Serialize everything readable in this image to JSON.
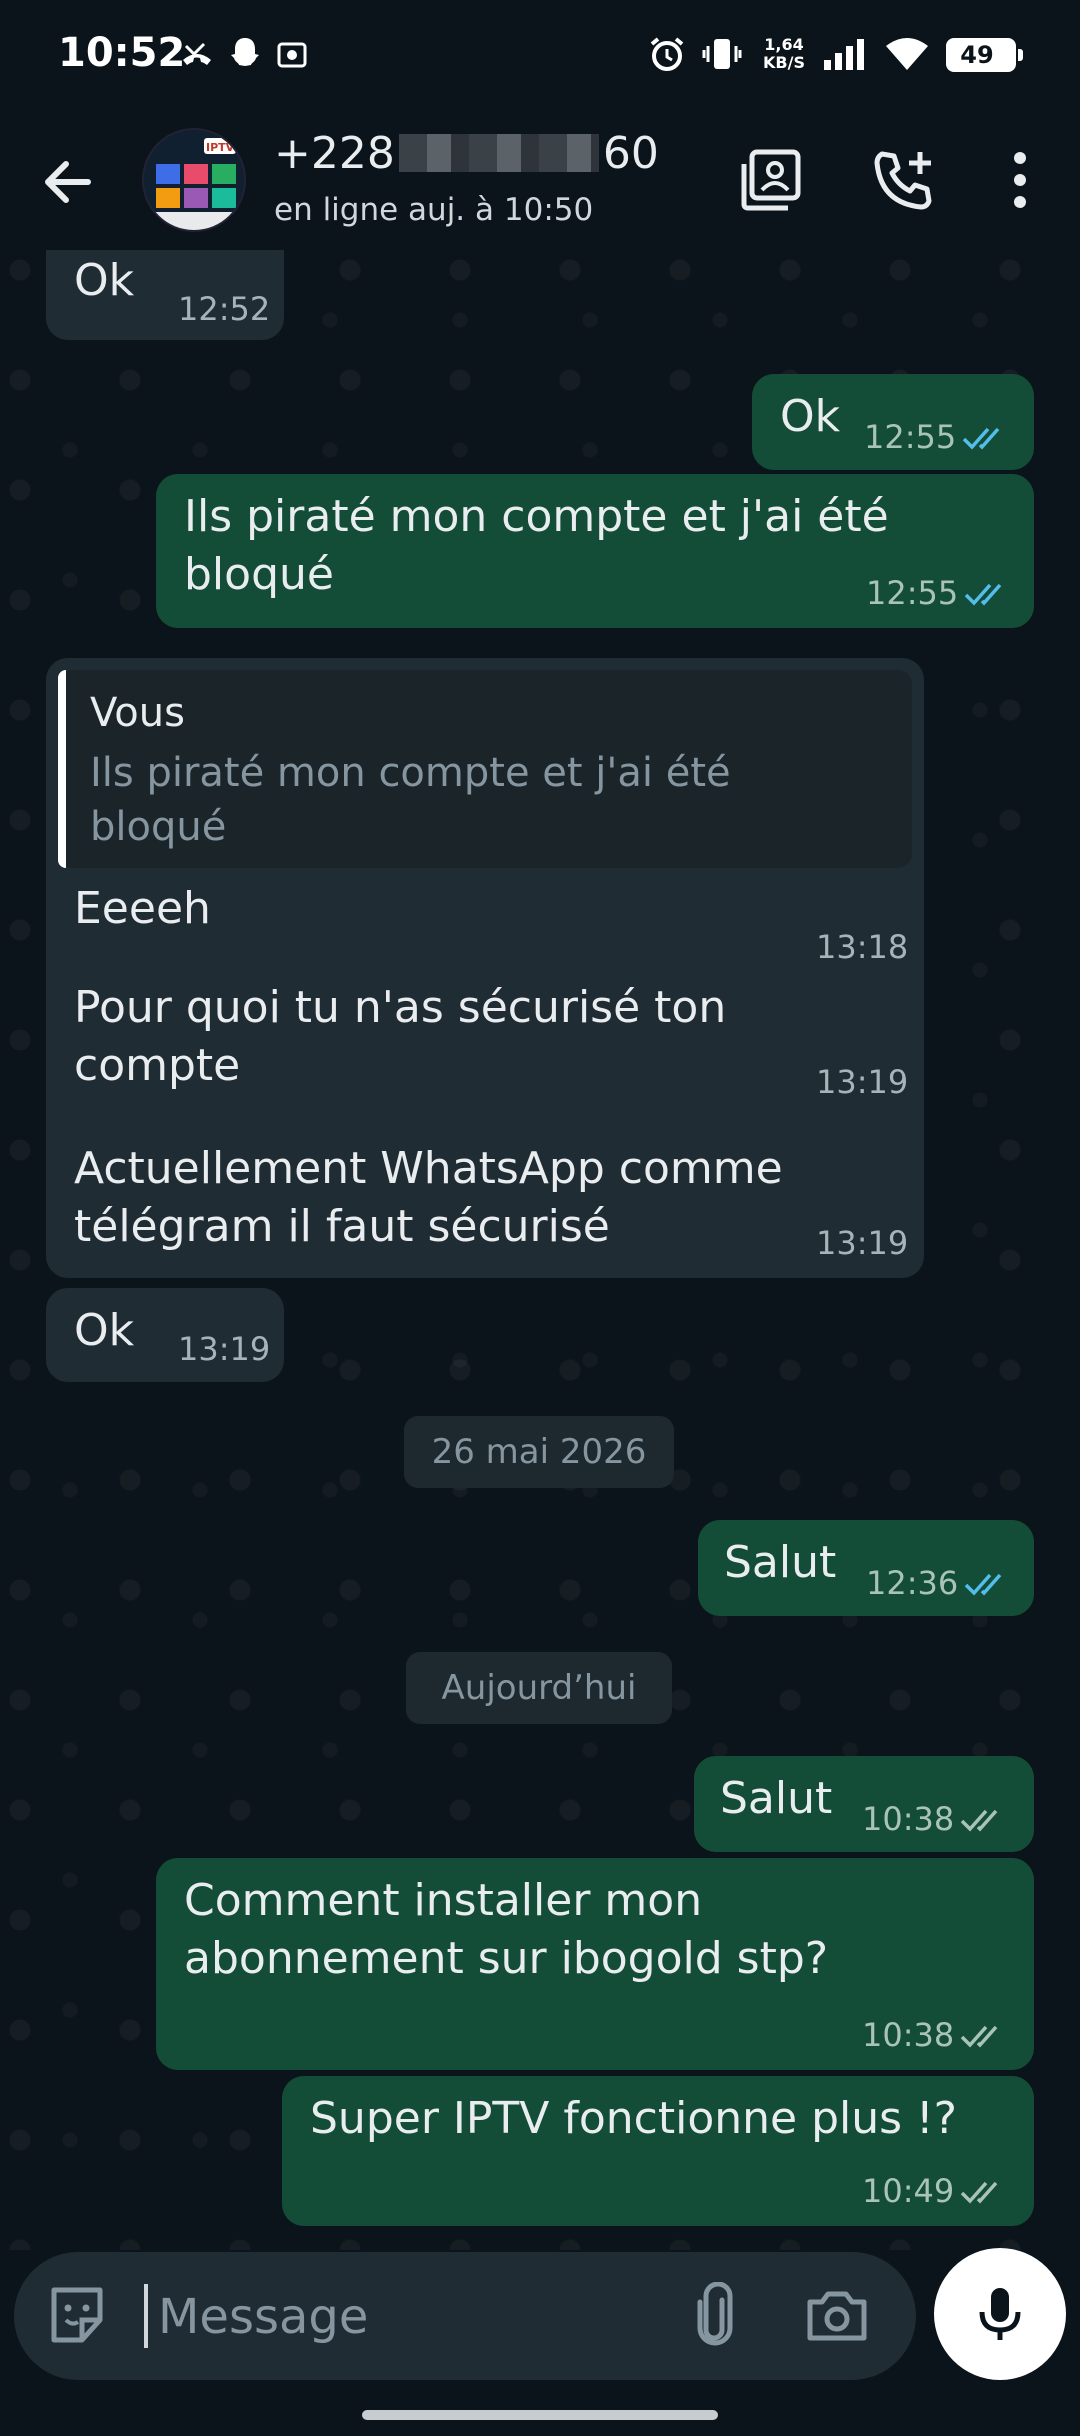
{
  "status_bar": {
    "time": "10:52",
    "net_speed_value": "1,64",
    "net_speed_unit": "KB/S",
    "battery": "49"
  },
  "header": {
    "back_icon": "arrow-left-icon",
    "name_prefix": "+228",
    "name_suffix": "60",
    "status": "en ligne auj. à 10:50",
    "actions": [
      "contact-card-icon",
      "add-call-icon",
      "more-vert-icon"
    ]
  },
  "messages": [
    {
      "dir": "in",
      "text": "Ok",
      "time": "12:52"
    },
    {
      "dir": "out",
      "text": "Ok",
      "time": "12:55",
      "ticks": "read"
    },
    {
      "dir": "out",
      "text": "Ils piraté mon compte et j'ai été bloqué",
      "time": "12:55",
      "ticks": "read"
    },
    {
      "dir": "in",
      "quote_author": "Vous",
      "quote_text": "Ils piraté mon compte et j'ai été bloqué",
      "text": "Eeeeh",
      "time": "13:18"
    },
    {
      "dir": "in",
      "text": "Pour quoi tu n'as sécurisé ton compte",
      "time": "13:19"
    },
    {
      "dir": "in",
      "text": "Actuellement WhatsApp comme télégram il faut sécurisé",
      "time": "13:19"
    },
    {
      "dir": "in",
      "text": "Ok",
      "time": "13:19"
    },
    {
      "dir": "out",
      "text": "Salut",
      "time": "12:36",
      "ticks": "read"
    },
    {
      "dir": "out",
      "text": "Salut",
      "time": "10:38",
      "ticks": "delivered"
    },
    {
      "dir": "out",
      "text": "Comment installer mon abonnement sur ibogold stp?",
      "time": "10:38",
      "ticks": "delivered"
    },
    {
      "dir": "out",
      "text": "Super IPTV fonctionne plus !?",
      "time": "10:49",
      "ticks": "delivered"
    }
  ],
  "date_separators": [
    "26 mai 2026",
    "Aujourd’hui"
  ],
  "composer": {
    "placeholder": "Message",
    "icons": [
      "sticker-icon",
      "paperclip-icon",
      "camera-icon",
      "microphone-icon"
    ]
  },
  "colors": {
    "background": "#0b141a",
    "incoming_bubble": "#202c33",
    "outgoing_bubble": "#134d37",
    "read_tick": "#53bdeb",
    "delivered_tick": "#a9c4b7"
  }
}
